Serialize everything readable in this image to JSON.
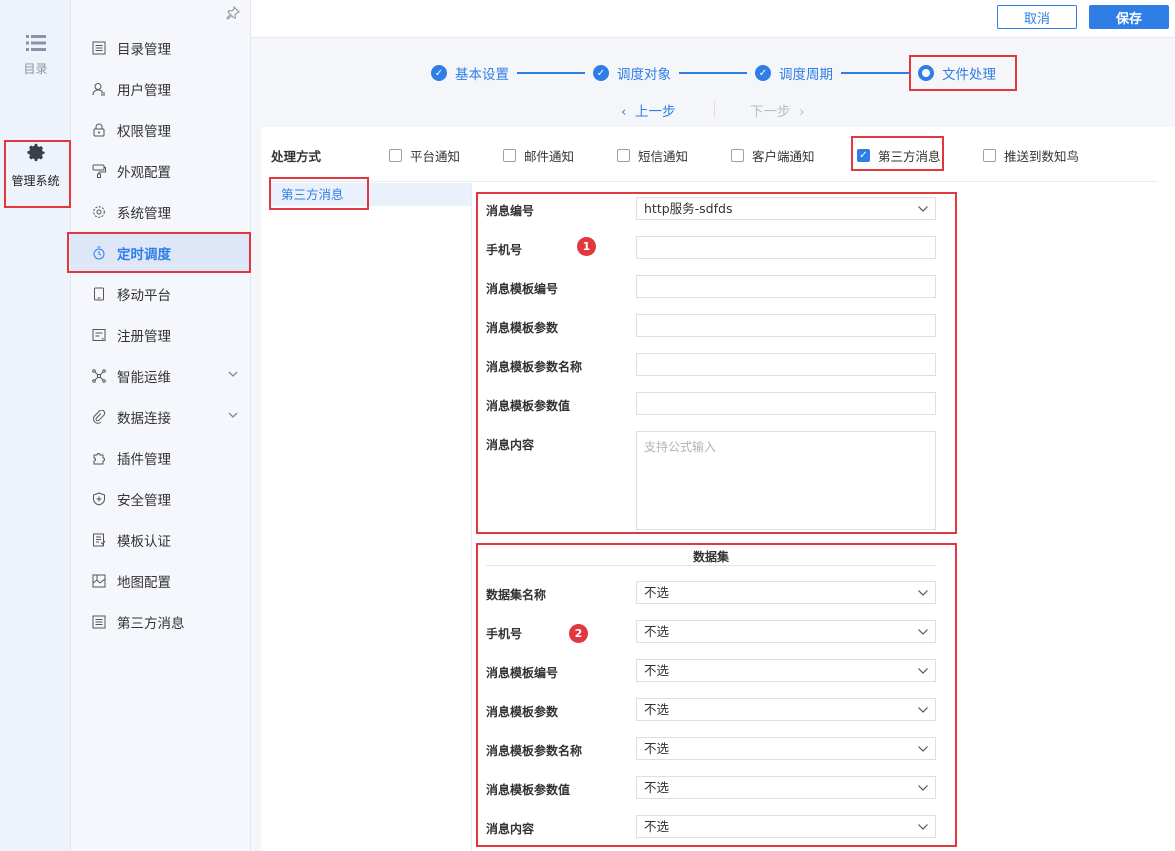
{
  "rail": {
    "catalog_label": "目录",
    "catalog_icon": "list-icon",
    "manage_label": "管理系统",
    "manage_icon": "gear-icon"
  },
  "sidebar": {
    "items": [
      {
        "label": "目录管理",
        "icon": "catalog-icon"
      },
      {
        "label": "用户管理",
        "icon": "user-icon"
      },
      {
        "label": "权限管理",
        "icon": "lock-icon"
      },
      {
        "label": "外观配置",
        "icon": "brush-icon"
      },
      {
        "label": "系统管理",
        "icon": "cog-icon"
      },
      {
        "label": "定时调度",
        "icon": "timer-icon",
        "active": true
      },
      {
        "label": "移动平台",
        "icon": "tablet-icon"
      },
      {
        "label": "注册管理",
        "icon": "register-icon"
      },
      {
        "label": "智能运维",
        "icon": "network-icon",
        "expandable": true
      },
      {
        "label": "数据连接",
        "icon": "link-icon",
        "expandable": true
      },
      {
        "label": "插件管理",
        "icon": "puzzle-icon"
      },
      {
        "label": "安全管理",
        "icon": "shield-icon"
      },
      {
        "label": "模板认证",
        "icon": "template-icon"
      },
      {
        "label": "地图配置",
        "icon": "map-icon"
      },
      {
        "label": "第三方消息",
        "icon": "message-icon"
      }
    ]
  },
  "toolbar": {
    "cancel_label": "取消",
    "save_label": "保存"
  },
  "steps": [
    {
      "label": "基本设置",
      "state": "done"
    },
    {
      "label": "调度对象",
      "state": "done"
    },
    {
      "label": "调度周期",
      "state": "done"
    },
    {
      "label": "文件处理",
      "state": "current"
    }
  ],
  "nav": {
    "prev_label": "上一步",
    "next_label": "下一步"
  },
  "processing": {
    "label": "处理方式",
    "options": [
      {
        "label": "平台通知",
        "checked": false
      },
      {
        "label": "邮件通知",
        "checked": false
      },
      {
        "label": "短信通知",
        "checked": false
      },
      {
        "label": "客户端通知",
        "checked": false
      },
      {
        "label": "第三方消息",
        "checked": true
      },
      {
        "label": "推送到数知鸟",
        "checked": false
      }
    ]
  },
  "sub_tab": "第三方消息",
  "section1": {
    "badge": "1",
    "fields": [
      {
        "label": "消息编号",
        "value": "http服务-sdfds",
        "type": "select"
      },
      {
        "label": "手机号",
        "value": "",
        "type": "text"
      },
      {
        "label": "消息模板编号",
        "value": "",
        "type": "text"
      },
      {
        "label": "消息模板参数",
        "value": "",
        "type": "text"
      },
      {
        "label": "消息模板参数名称",
        "value": "",
        "type": "text"
      },
      {
        "label": "消息模板参数值",
        "value": "",
        "type": "text"
      }
    ],
    "content_label": "消息内容",
    "content_placeholder": "支持公式输入"
  },
  "section2": {
    "badge": "2",
    "title": "数据集",
    "fields": [
      {
        "label": "数据集名称",
        "value": "不选"
      },
      {
        "label": "手机号",
        "value": "不选"
      },
      {
        "label": "消息模板编号",
        "value": "不选"
      },
      {
        "label": "消息模板参数",
        "value": "不选"
      },
      {
        "label": "消息模板参数名称",
        "value": "不选"
      },
      {
        "label": "消息模板参数值",
        "value": "不选"
      },
      {
        "label": "消息内容",
        "value": "不选"
      }
    ]
  },
  "colors": {
    "accent": "#2f7ee5",
    "highlight": "#e0383e"
  }
}
